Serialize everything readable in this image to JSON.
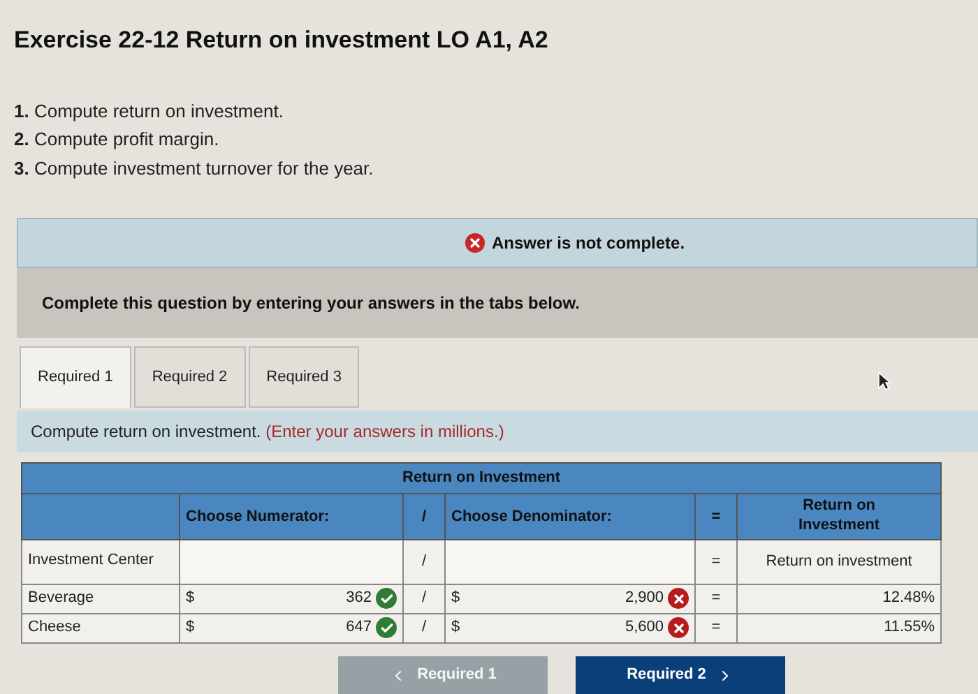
{
  "title": "Exercise 22-12 Return on investment LO A1, A2",
  "tasks": [
    {
      "number": "1.",
      "text": "Compute return on investment."
    },
    {
      "number": "2.",
      "text": "Compute profit margin."
    },
    {
      "number": "3.",
      "text": "Compute investment turnover for the year."
    }
  ],
  "banner": {
    "text": "Answer is not complete."
  },
  "prompt": "Complete this question by entering your answers in the tabs below.",
  "tabs": [
    {
      "label": "Required 1",
      "selected": true
    },
    {
      "label": "Required 2",
      "selected": false
    },
    {
      "label": "Required 3",
      "selected": false
    }
  ],
  "instruction": {
    "text": "Compute return on investment.",
    "note": "(Enter your answers in millions.)"
  },
  "table": {
    "title": "Return on Investment",
    "columns": [
      "Choose Numerator:",
      "/",
      "Choose Denominator:",
      "=",
      "Return on Investment"
    ],
    "label_row": {
      "label": "Investment Center",
      "divide": "/",
      "equals": "=",
      "result": "Return on investment"
    },
    "rows": [
      {
        "name": "Beverage",
        "cur1": "$",
        "numerator": "362",
        "numerator_correct": true,
        "divide": "/",
        "cur2": "$",
        "denominator": "2,900",
        "denominator_correct": false,
        "equals": "=",
        "result": "12.48%"
      },
      {
        "name": "Cheese",
        "cur1": "$",
        "numerator": "647",
        "numerator_correct": true,
        "divide": "/",
        "cur2": "$",
        "denominator": "5,600",
        "denominator_correct": false,
        "equals": "=",
        "result": "11.55%"
      }
    ]
  },
  "nav": [
    {
      "label": "Required 1",
      "kind": "prev",
      "disabled": true
    },
    {
      "label": "Required 2",
      "kind": "next",
      "disabled": false
    }
  ]
}
